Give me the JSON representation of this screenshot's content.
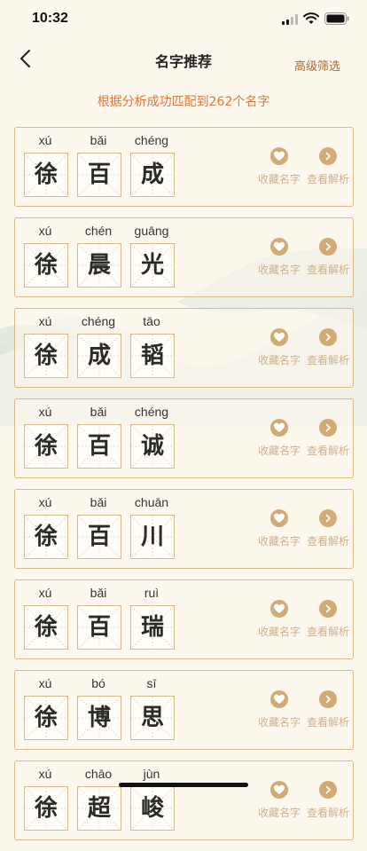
{
  "status": {
    "time": "10:32"
  },
  "nav": {
    "title": "名字推荐",
    "filter": "高级筛选"
  },
  "summary": "根据分析成功匹配到262个名字",
  "actions": {
    "favorite": "收藏名字",
    "analysis": "查看解析"
  },
  "names": [
    {
      "chars": [
        {
          "pinyin": "xú",
          "hanzi": "徐"
        },
        {
          "pinyin": "bǎi",
          "hanzi": "百"
        },
        {
          "pinyin": "chéng",
          "hanzi": "成"
        }
      ]
    },
    {
      "chars": [
        {
          "pinyin": "xú",
          "hanzi": "徐"
        },
        {
          "pinyin": "chén",
          "hanzi": "晨"
        },
        {
          "pinyin": "guāng",
          "hanzi": "光"
        }
      ]
    },
    {
      "chars": [
        {
          "pinyin": "xú",
          "hanzi": "徐"
        },
        {
          "pinyin": "chéng",
          "hanzi": "成"
        },
        {
          "pinyin": "tāo",
          "hanzi": "韬"
        }
      ]
    },
    {
      "chars": [
        {
          "pinyin": "xú",
          "hanzi": "徐"
        },
        {
          "pinyin": "bǎi",
          "hanzi": "百"
        },
        {
          "pinyin": "chéng",
          "hanzi": "诚"
        }
      ]
    },
    {
      "chars": [
        {
          "pinyin": "xú",
          "hanzi": "徐"
        },
        {
          "pinyin": "bǎi",
          "hanzi": "百"
        },
        {
          "pinyin": "chuān",
          "hanzi": "川"
        }
      ]
    },
    {
      "chars": [
        {
          "pinyin": "xú",
          "hanzi": "徐"
        },
        {
          "pinyin": "bǎi",
          "hanzi": "百"
        },
        {
          "pinyin": "ruì",
          "hanzi": "瑞"
        }
      ]
    },
    {
      "chars": [
        {
          "pinyin": "xú",
          "hanzi": "徐"
        },
        {
          "pinyin": "bó",
          "hanzi": "博"
        },
        {
          "pinyin": "sī",
          "hanzi": "思"
        }
      ]
    },
    {
      "chars": [
        {
          "pinyin": "xú",
          "hanzi": "徐"
        },
        {
          "pinyin": "chāo",
          "hanzi": "超"
        },
        {
          "pinyin": "jùn",
          "hanzi": "峻"
        }
      ]
    }
  ],
  "colors": {
    "accent": "#d2ab74",
    "highlight": "#e0763a",
    "border": "#d8b98a"
  }
}
